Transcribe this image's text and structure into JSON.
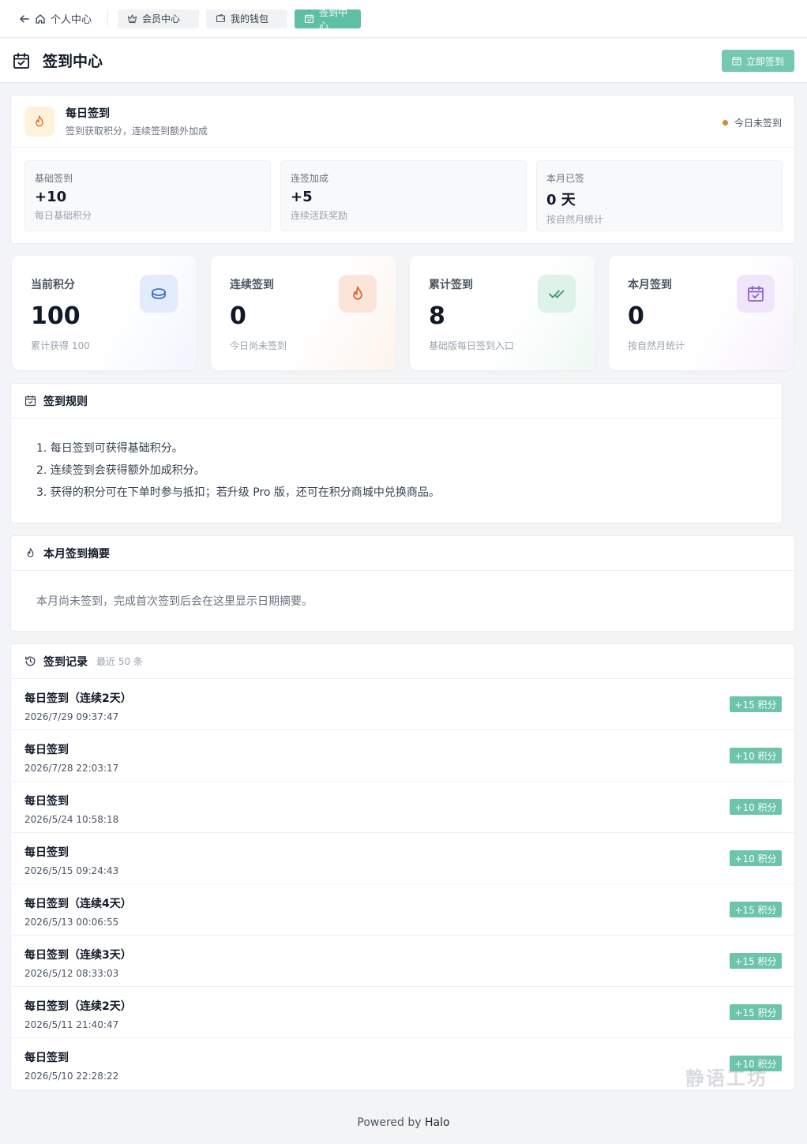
{
  "nav": {
    "back_label": "个人中心",
    "tabs": [
      {
        "label": "会员中心",
        "icon": "crown-icon"
      },
      {
        "label": "我的钱包",
        "icon": "wallet-icon"
      },
      {
        "label": "签到中心",
        "icon": "calendar-check-icon",
        "active": true
      }
    ]
  },
  "header": {
    "title": "签到中心",
    "signin_button": "立即签到"
  },
  "daily": {
    "title": "每日签到",
    "subtitle": "签到获取积分，连续签到额外加成",
    "status": "今日未签到",
    "items": [
      {
        "label": "基础签到",
        "value": "+10",
        "sub": "每日基础积分"
      },
      {
        "label": "连签加成",
        "value": "+5",
        "sub": "连续活跃奖励"
      },
      {
        "label": "本月已签",
        "value": "0 天",
        "sub": "按自然月统计"
      }
    ]
  },
  "stats": [
    {
      "label": "当前积分",
      "value": "100",
      "sub": "累计获得 100",
      "icon": "coin-icon",
      "accent": "#3b6fd4"
    },
    {
      "label": "连续签到",
      "value": "0",
      "sub": "今日尚未签到",
      "icon": "fire-icon",
      "accent": "#e0662f"
    },
    {
      "label": "累计签到",
      "value": "8",
      "sub": "基础版每日签到入口",
      "icon": "double-check-icon",
      "accent": "#2f9e6e"
    },
    {
      "label": "本月签到",
      "value": "0",
      "sub": "按自然月统计",
      "icon": "calendar-check-icon",
      "accent": "#8b5cc7"
    }
  ],
  "rules": {
    "title": "签到规则",
    "items": [
      "1. 每日签到可获得基础积分。",
      "2. 连续签到会获得额外加成积分。",
      "3. 获得的积分可在下单时参与抵扣；若升级 Pro 版，还可在积分商城中兑换商品。"
    ]
  },
  "summary": {
    "title": "本月签到摘要",
    "text": "本月尚未签到，完成首次签到后会在这里显示日期摘要。"
  },
  "records": {
    "title": "签到记录",
    "extra": "最近 50 条",
    "rows": [
      {
        "title": "每日签到（连续2天）",
        "time": "2026/7/29 09:37:47",
        "badge": "+15 积分"
      },
      {
        "title": "每日签到",
        "time": "2026/7/28 22:03:17",
        "badge": "+10 积分"
      },
      {
        "title": "每日签到",
        "time": "2026/5/24 10:58:18",
        "badge": "+10 积分"
      },
      {
        "title": "每日签到",
        "time": "2026/5/15 09:24:43",
        "badge": "+10 积分"
      },
      {
        "title": "每日签到（连续4天）",
        "time": "2026/5/13 00:06:55",
        "badge": "+15 积分"
      },
      {
        "title": "每日签到（连续3天）",
        "time": "2026/5/12 08:33:03",
        "badge": "+15 积分"
      },
      {
        "title": "每日签到（连续2天）",
        "time": "2026/5/11 21:40:47",
        "badge": "+15 积分"
      },
      {
        "title": "每日签到",
        "time": "2026/5/10 22:28:22",
        "badge": "+10 积分"
      }
    ]
  },
  "watermark": "静语工坊",
  "footer": {
    "prefix": "Powered by",
    "brand": "Halo"
  }
}
